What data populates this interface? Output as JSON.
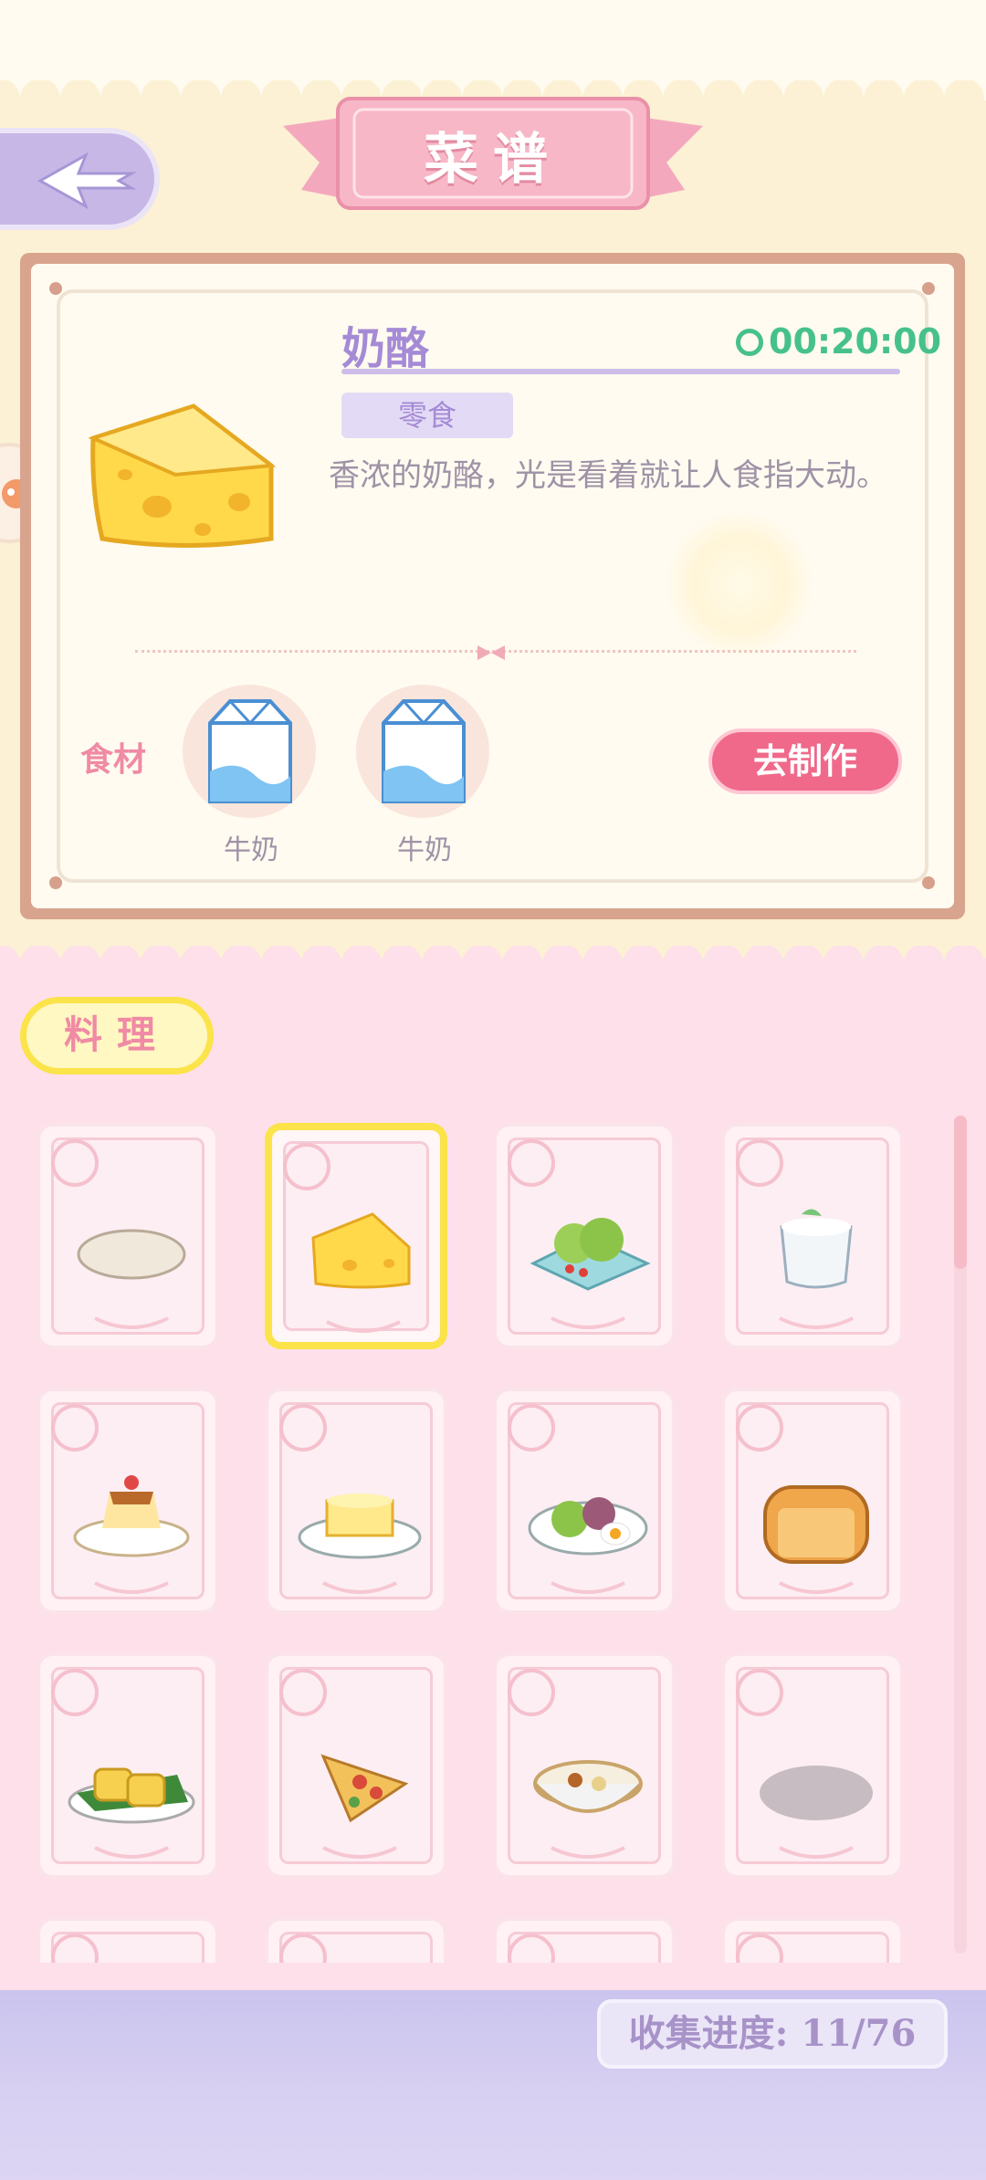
{
  "header": {
    "title": "菜谱"
  },
  "icons": {
    "back": "back-arrow-icon",
    "timer": "clock-icon"
  },
  "recipe": {
    "name": "奶酪",
    "time": "00:20:00",
    "category_tag": "零食",
    "description": "香浓的奶酪，光是看着就让人食指大动。",
    "ingredients_label": "食材",
    "ingredients": [
      {
        "name": "牛奶",
        "icon": "milk-carton-icon"
      },
      {
        "name": "牛奶",
        "icon": "milk-carton-icon"
      }
    ],
    "make_button": "去制作"
  },
  "category": {
    "label": "料理"
  },
  "dishes": [
    {
      "icon": "flatbread-icon",
      "selected": false
    },
    {
      "icon": "cheese-icon",
      "selected": true
    },
    {
      "icon": "salad-icon",
      "selected": false
    },
    {
      "icon": "yogurt-icon",
      "selected": false
    },
    {
      "icon": "pudding-icon",
      "selected": false
    },
    {
      "icon": "cheese-plate-icon",
      "selected": false
    },
    {
      "icon": "egg-salad-icon",
      "selected": false
    },
    {
      "icon": "bread-loaf-icon",
      "selected": false
    },
    {
      "icon": "tamagoyaki-icon",
      "selected": false
    },
    {
      "icon": "pizza-slice-icon",
      "selected": false
    },
    {
      "icon": "soup-bowl-icon",
      "selected": false
    },
    {
      "icon": "locked-dish-icon",
      "selected": false
    },
    {
      "icon": "dish-icon",
      "selected": false
    },
    {
      "icon": "dish-icon",
      "selected": false
    },
    {
      "icon": "dish-icon",
      "selected": false
    },
    {
      "icon": "dish-icon",
      "selected": false
    }
  ],
  "progress": {
    "text": "收集进度: 11/76",
    "collected": 11,
    "total": 76
  },
  "colors": {
    "accent_pink": "#f0698a",
    "accent_purple": "#a58bd6",
    "timer_green": "#47c18b",
    "select_yellow": "#fbe34a"
  }
}
